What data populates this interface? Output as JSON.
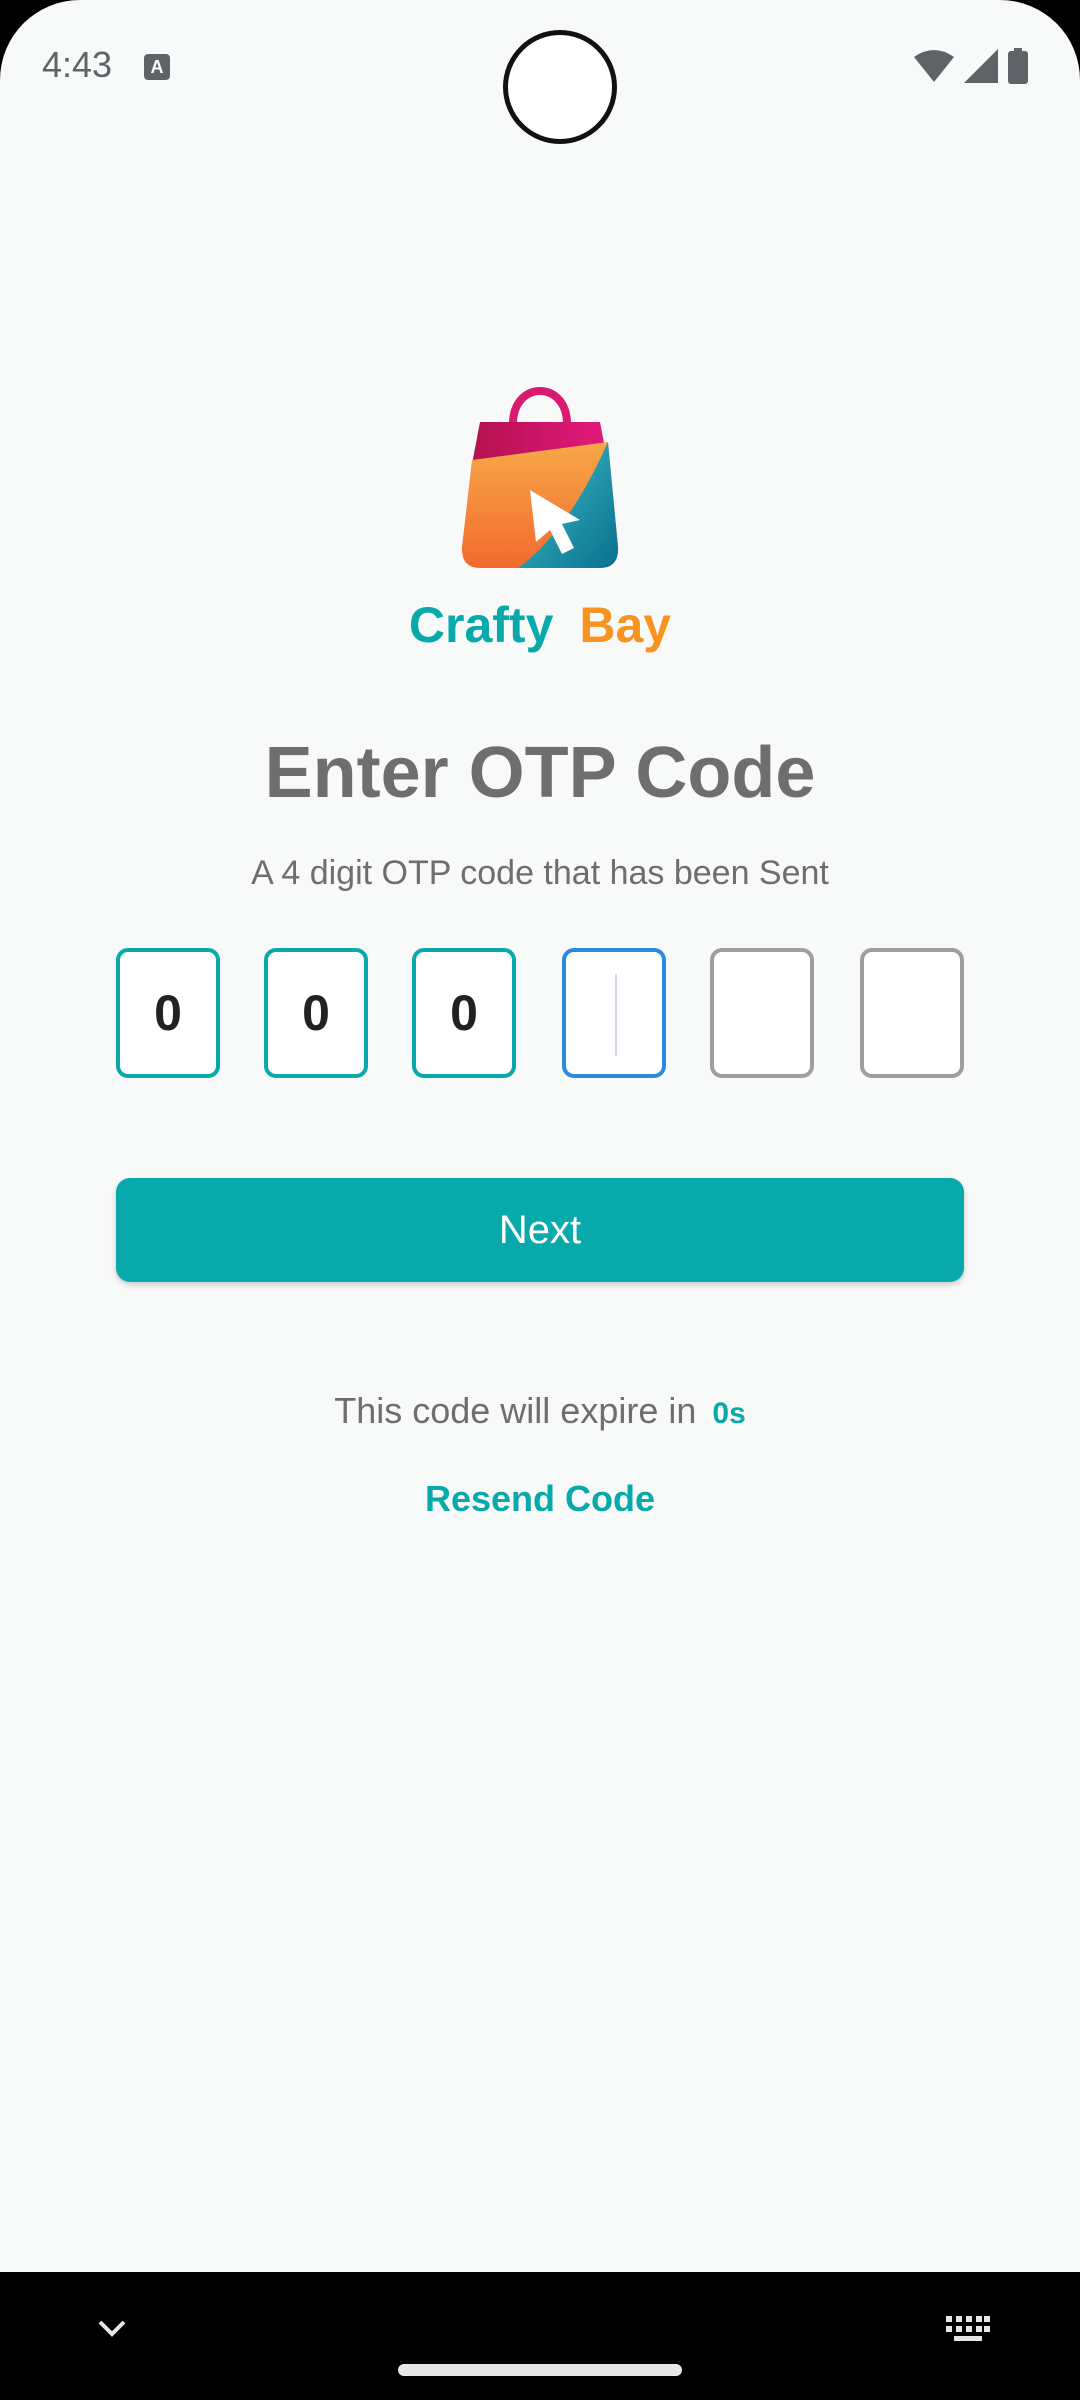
{
  "status_bar": {
    "time": "4:43",
    "notification_icon": "a-icon",
    "icons": [
      "wifi-icon",
      "signal-icon",
      "battery-icon"
    ]
  },
  "brand": {
    "logo_icon": "shopping-bag-icon",
    "name_part1": "Crafty",
    "name_part2": "Bay",
    "colors": {
      "primary": "#07a9ab",
      "accent": "#f7931e"
    }
  },
  "screen": {
    "title": "Enter OTP Code",
    "subtitle": "A 4 digit OTP code that has been Sent"
  },
  "otp": {
    "digits": [
      "0",
      "0",
      "0",
      "",
      "",
      ""
    ],
    "active_index": 3
  },
  "actions": {
    "next_label": "Next",
    "expire_text": "This code will expire in",
    "expire_count": "0s",
    "resend_label": "Resend Code"
  },
  "nav_bar": {
    "left_icon": "chevron-down-icon",
    "right_icon": "keyboard-icon"
  }
}
